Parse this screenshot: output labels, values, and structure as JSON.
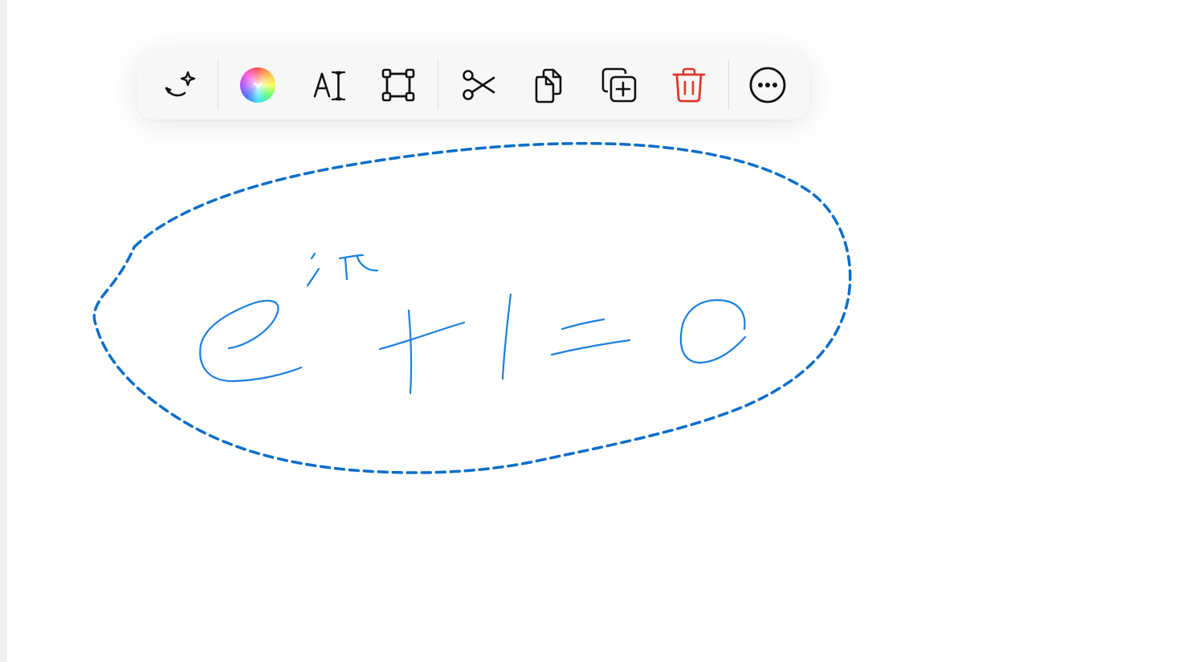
{
  "toolbar": {
    "buttons": [
      {
        "name": "math-assist-icon"
      },
      {
        "name": "color-picker"
      },
      {
        "name": "convert-to-text-icon"
      },
      {
        "name": "transform-icon"
      },
      {
        "name": "cut-icon"
      },
      {
        "name": "copy-icon"
      },
      {
        "name": "duplicate-icon"
      },
      {
        "name": "delete-icon"
      },
      {
        "name": "more-icon"
      }
    ],
    "delete_color": "#e0352b"
  },
  "drawing": {
    "stroke_color": "#1a7fe0",
    "selection_color": "#0b6ec9"
  }
}
